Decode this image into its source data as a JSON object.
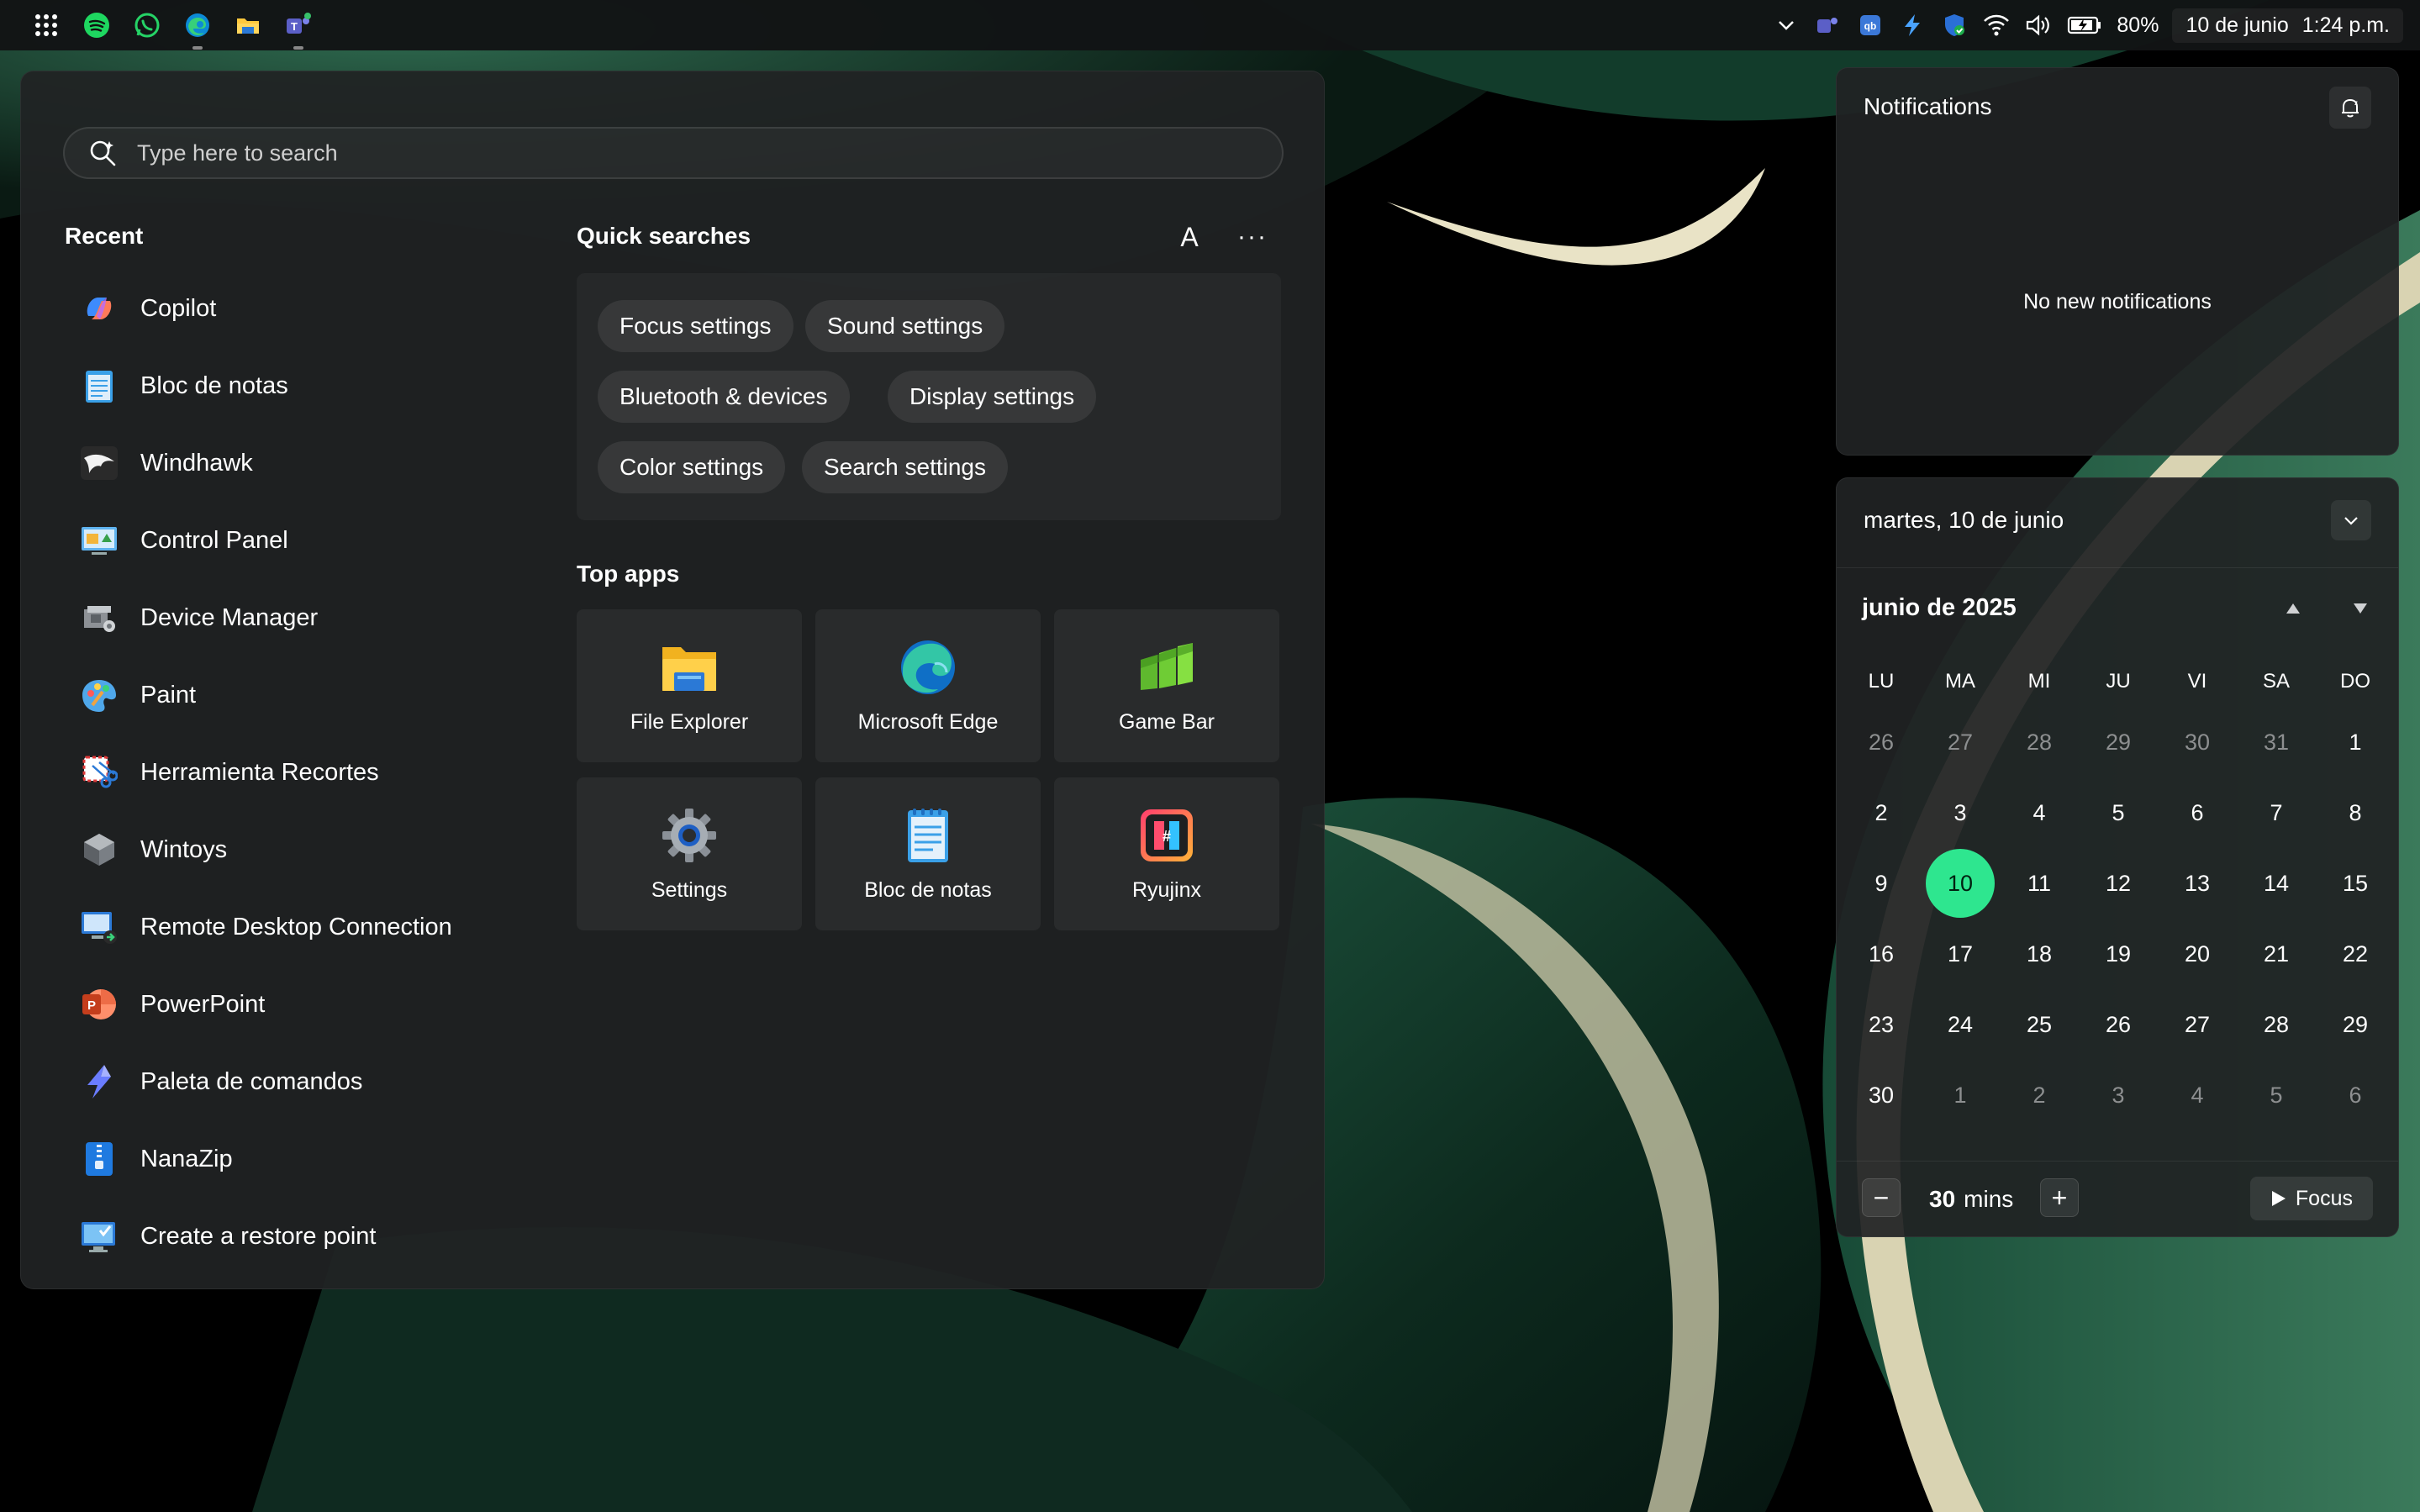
{
  "taskbar": {
    "left_icons": [
      "apps-grid-icon",
      "spotify-icon",
      "whatsapp-icon",
      "edge-icon",
      "file-explorer-icon",
      "teams-icon"
    ],
    "tray_icons": [
      "chevron-down-icon",
      "teams-tray-icon",
      "qbittorrent-icon",
      "powertoys-icon",
      "defender-icon",
      "wifi-icon",
      "volume-icon",
      "battery-icon"
    ],
    "battery": "80%",
    "date": "10 de junio",
    "time": "1:24 p.m."
  },
  "search": {
    "placeholder": "Type here to search"
  },
  "recent": {
    "title": "Recent",
    "items": [
      {
        "label": "Copilot",
        "icon": "copilot-icon"
      },
      {
        "label": "Bloc de notas",
        "icon": "notepad-icon"
      },
      {
        "label": "Windhawk",
        "icon": "windhawk-icon"
      },
      {
        "label": "Control Panel",
        "icon": "control-panel-icon"
      },
      {
        "label": "Device Manager",
        "icon": "device-manager-icon"
      },
      {
        "label": "Paint",
        "icon": "paint-icon"
      },
      {
        "label": "Herramienta Recortes",
        "icon": "snipping-tool-icon"
      },
      {
        "label": "Wintoys",
        "icon": "wintoys-icon"
      },
      {
        "label": "Remote Desktop Connection",
        "icon": "remote-desktop-icon"
      },
      {
        "label": "PowerPoint",
        "icon": "powerpoint-icon"
      },
      {
        "label": "Paleta de comandos",
        "icon": "command-palette-icon"
      },
      {
        "label": "NanaZip",
        "icon": "nanazip-icon"
      },
      {
        "label": "Create a restore point",
        "icon": "restore-point-icon"
      }
    ]
  },
  "quick_searches": {
    "title": "Quick searches",
    "account_letter": "A",
    "more": "···",
    "chips": [
      "Focus settings",
      "Sound settings",
      "Bluetooth & devices",
      "Display settings",
      "Color settings",
      "Search settings"
    ]
  },
  "top_apps": {
    "title": "Top apps",
    "apps": [
      {
        "label": "File Explorer",
        "icon": "file-explorer-icon"
      },
      {
        "label": "Microsoft Edge",
        "icon": "edge-icon"
      },
      {
        "label": "Game Bar",
        "icon": "game-bar-icon"
      },
      {
        "label": "Settings",
        "icon": "settings-gear-icon"
      },
      {
        "label": "Bloc de notas",
        "icon": "notepad-icon"
      },
      {
        "label": "Ryujinx",
        "icon": "ryujinx-icon"
      }
    ]
  },
  "notifications": {
    "title": "Notifications",
    "empty_text": "No new notifications"
  },
  "calendar": {
    "date_header": "martes, 10 de junio",
    "month_label": "junio de 2025",
    "weekdays": [
      "LU",
      "MA",
      "MI",
      "JU",
      "VI",
      "SA",
      "DO"
    ],
    "weeks": [
      [
        "26",
        "27",
        "28",
        "29",
        "30",
        "31",
        "1"
      ],
      [
        "2",
        "3",
        "4",
        "5",
        "6",
        "7",
        "8"
      ],
      [
        "9",
        "10",
        "11",
        "12",
        "13",
        "14",
        "15"
      ],
      [
        "16",
        "17",
        "18",
        "19",
        "20",
        "21",
        "22"
      ],
      [
        "23",
        "24",
        "25",
        "26",
        "27",
        "28",
        "29"
      ],
      [
        "30",
        "1",
        "2",
        "3",
        "4",
        "5",
        "6"
      ]
    ],
    "today": "10",
    "accent": "#2ee68f",
    "focus": {
      "minus": "−",
      "minutes": "30",
      "unit": "mins",
      "plus": "+",
      "button": "Focus"
    }
  }
}
